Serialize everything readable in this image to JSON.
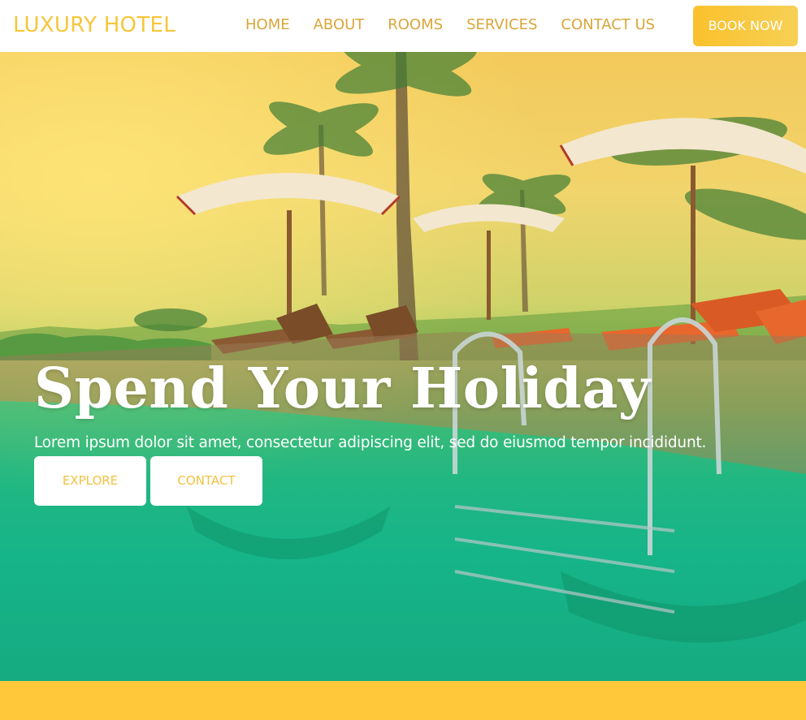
{
  "header": {
    "logo": "LUXURY HOTEL",
    "nav": [
      "HOME",
      "ABOUT",
      "ROOMS",
      "SERVICES",
      "CONTACT US"
    ],
    "book_label": "BOOK NOW"
  },
  "hero": {
    "title": "Spend Your Holiday",
    "subtitle": "Lorem ipsum dolor sit amet, consectetur adipiscing elit, sed do eiusmod tempor incididunt.",
    "explore_label": "EXPLORE",
    "contact_label": "CONTACT"
  },
  "colors": {
    "accent": "#ffc83a",
    "nav_text": "#d9a63a",
    "logo_text": "#f7c63a",
    "button_text": "#f2c13f"
  }
}
